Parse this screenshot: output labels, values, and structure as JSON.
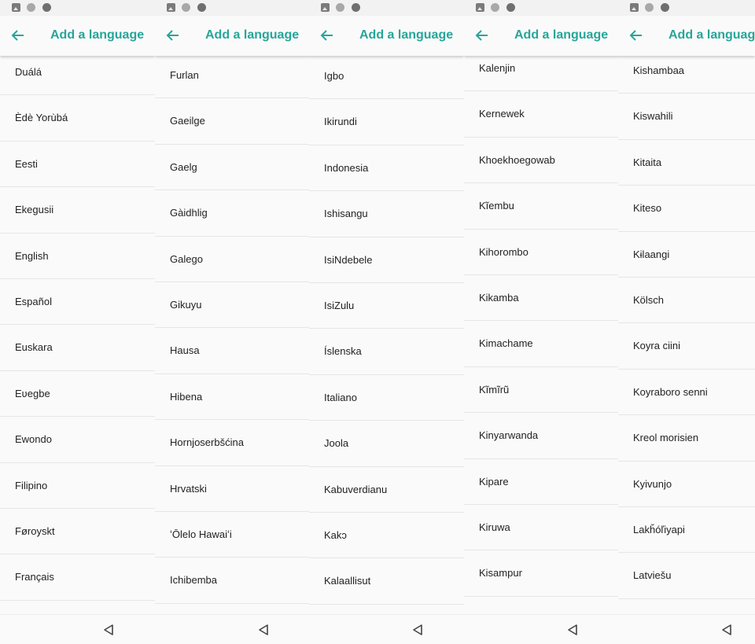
{
  "app": {
    "title": "Add a language",
    "accent_color": "#26a69a",
    "back_icon": "arrow-left-icon",
    "nav_back_icon": "triangle-back-icon"
  },
  "screens": [
    {
      "title": "Add a language",
      "items": [
        "Duálá",
        "Èdè Yorùbá",
        "Eesti",
        "Ekegusii",
        "English",
        "Español",
        "Euskara",
        "Eʋegbe",
        "Ewondo",
        "Filipino",
        "Føroyskt",
        "Français"
      ]
    },
    {
      "title": "Add a language",
      "items": [
        "Furlan",
        "Gaeilge",
        "Gaelg",
        "Gàidhlig",
        "Galego",
        "Gikuyu",
        "Hausa",
        "Hibena",
        "Hornjoserbšćina",
        "Hrvatski",
        "ʻŌlelo Hawaiʻi",
        "Ichibemba"
      ]
    },
    {
      "title": "Add a language",
      "items": [
        "Igbo",
        "Ikirundi",
        "Indonesia",
        "Ishisangu",
        "IsiNdebele",
        "IsiZulu",
        "Íslenska",
        "Italiano",
        "Joola",
        "Kabuverdianu",
        "Kakɔ",
        "Kalaallisut"
      ]
    },
    {
      "title": "Add a language",
      "items": [
        "Kalenjin",
        "Kernewek",
        "Khoekhoegowab",
        "Kĩembu",
        "Kihorombo",
        "Kikamba",
        "Kimachame",
        "Kĩmĩrũ",
        "Kinyarwanda",
        "Kipare",
        "Kiruwa",
        "Kisampur"
      ]
    },
    {
      "title": "Add a language",
      "items": [
        "Kishambaa",
        "Kiswahili",
        "Kitaita",
        "Kiteso",
        "Kɨlaangi",
        "Kölsch",
        "Koyra ciini",
        "Koyraboro senni",
        "Kreol morisien",
        "Kyivunjo",
        "Lakȟóľiyapi",
        "Latviešu"
      ]
    }
  ]
}
